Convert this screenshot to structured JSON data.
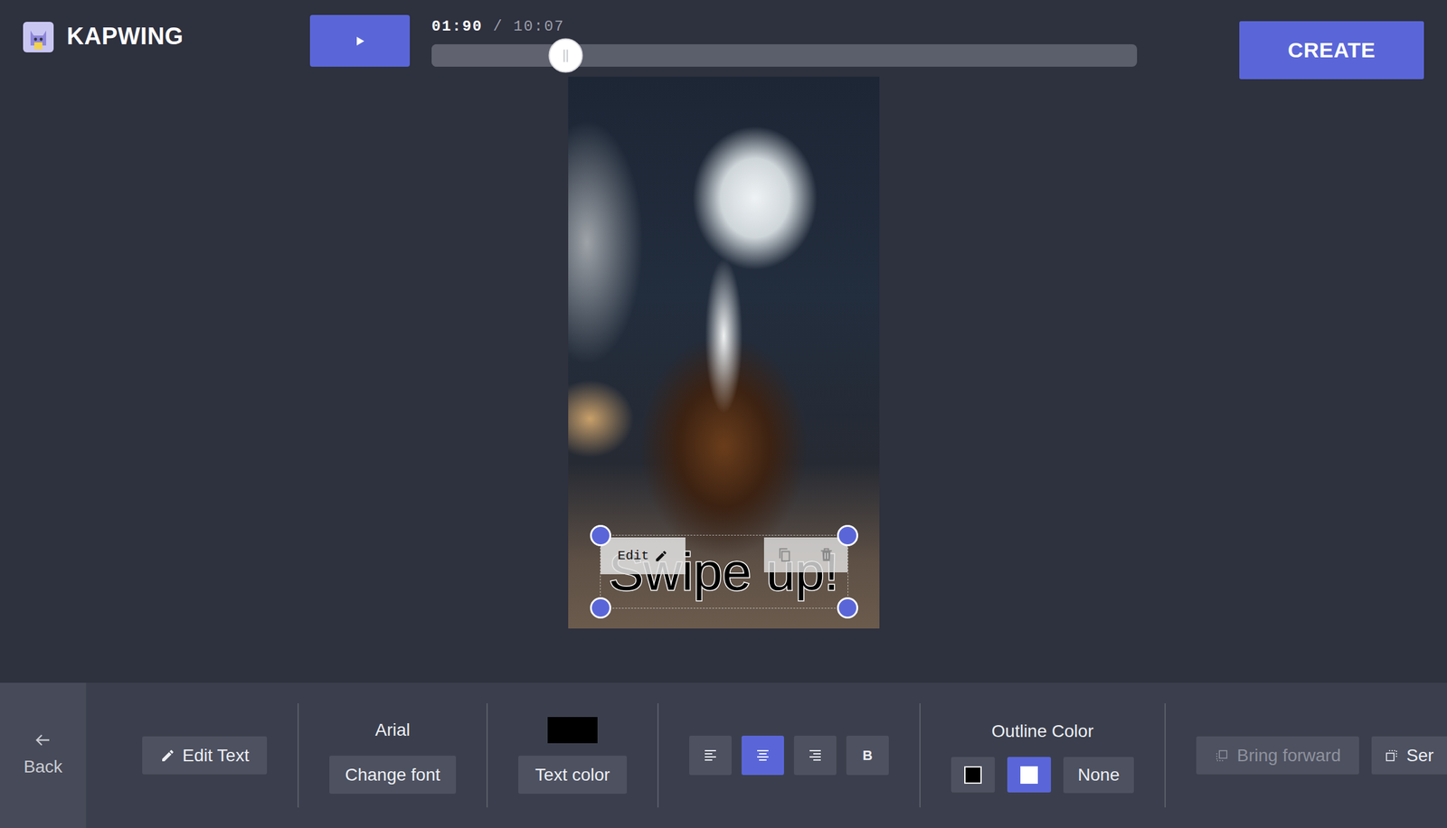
{
  "brand": {
    "name": "KAPWING"
  },
  "player": {
    "current_time": "01:90",
    "separator": "/",
    "duration": "10:07",
    "level": 0.19
  },
  "create_button": "CREATE",
  "canvas": {
    "text_layer": {
      "text": "Swipe up!",
      "selected": true,
      "edit_label": "Edit"
    }
  },
  "toolbar": {
    "back": "Back",
    "edit_text": "Edit Text",
    "font": {
      "name": "Arial",
      "button": "Change font"
    },
    "text_color": {
      "color": "#000000",
      "button": "Text color"
    },
    "align_buttons": [
      {
        "kind": "left",
        "selected": false
      },
      {
        "kind": "center",
        "selected": true
      },
      {
        "kind": "right",
        "selected": false
      },
      {
        "kind": "bold",
        "label": "B",
        "selected": false
      }
    ],
    "outline": {
      "label": "Outline Color",
      "options": [
        {
          "kind": "swatch",
          "color": "#000000",
          "selected": false
        },
        {
          "kind": "swatch",
          "color": "#ffffff",
          "selected": true
        },
        {
          "kind": "none",
          "label": "None",
          "selected": false
        }
      ]
    },
    "layer_buttons": [
      {
        "kind": "forward",
        "label": "Bring forward",
        "disabled": true
      },
      {
        "kind": "backward",
        "label": "Ser",
        "disabled": false
      }
    ]
  }
}
